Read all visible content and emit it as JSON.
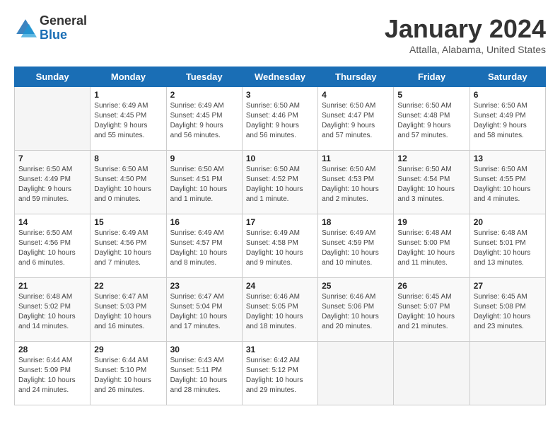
{
  "header": {
    "logo_general": "General",
    "logo_blue": "Blue",
    "title": "January 2024",
    "location": "Attalla, Alabama, United States"
  },
  "days_of_week": [
    "Sunday",
    "Monday",
    "Tuesday",
    "Wednesday",
    "Thursday",
    "Friday",
    "Saturday"
  ],
  "weeks": [
    [
      {
        "day": "",
        "info": ""
      },
      {
        "day": "1",
        "info": "Sunrise: 6:49 AM\nSunset: 4:45 PM\nDaylight: 9 hours\nand 55 minutes."
      },
      {
        "day": "2",
        "info": "Sunrise: 6:49 AM\nSunset: 4:45 PM\nDaylight: 9 hours\nand 56 minutes."
      },
      {
        "day": "3",
        "info": "Sunrise: 6:50 AM\nSunset: 4:46 PM\nDaylight: 9 hours\nand 56 minutes."
      },
      {
        "day": "4",
        "info": "Sunrise: 6:50 AM\nSunset: 4:47 PM\nDaylight: 9 hours\nand 57 minutes."
      },
      {
        "day": "5",
        "info": "Sunrise: 6:50 AM\nSunset: 4:48 PM\nDaylight: 9 hours\nand 57 minutes."
      },
      {
        "day": "6",
        "info": "Sunrise: 6:50 AM\nSunset: 4:49 PM\nDaylight: 9 hours\nand 58 minutes."
      }
    ],
    [
      {
        "day": "7",
        "info": "Sunrise: 6:50 AM\nSunset: 4:49 PM\nDaylight: 9 hours\nand 59 minutes."
      },
      {
        "day": "8",
        "info": "Sunrise: 6:50 AM\nSunset: 4:50 PM\nDaylight: 10 hours\nand 0 minutes."
      },
      {
        "day": "9",
        "info": "Sunrise: 6:50 AM\nSunset: 4:51 PM\nDaylight: 10 hours\nand 1 minute."
      },
      {
        "day": "10",
        "info": "Sunrise: 6:50 AM\nSunset: 4:52 PM\nDaylight: 10 hours\nand 1 minute."
      },
      {
        "day": "11",
        "info": "Sunrise: 6:50 AM\nSunset: 4:53 PM\nDaylight: 10 hours\nand 2 minutes."
      },
      {
        "day": "12",
        "info": "Sunrise: 6:50 AM\nSunset: 4:54 PM\nDaylight: 10 hours\nand 3 minutes."
      },
      {
        "day": "13",
        "info": "Sunrise: 6:50 AM\nSunset: 4:55 PM\nDaylight: 10 hours\nand 4 minutes."
      }
    ],
    [
      {
        "day": "14",
        "info": "Sunrise: 6:50 AM\nSunset: 4:56 PM\nDaylight: 10 hours\nand 6 minutes."
      },
      {
        "day": "15",
        "info": "Sunrise: 6:49 AM\nSunset: 4:56 PM\nDaylight: 10 hours\nand 7 minutes."
      },
      {
        "day": "16",
        "info": "Sunrise: 6:49 AM\nSunset: 4:57 PM\nDaylight: 10 hours\nand 8 minutes."
      },
      {
        "day": "17",
        "info": "Sunrise: 6:49 AM\nSunset: 4:58 PM\nDaylight: 10 hours\nand 9 minutes."
      },
      {
        "day": "18",
        "info": "Sunrise: 6:49 AM\nSunset: 4:59 PM\nDaylight: 10 hours\nand 10 minutes."
      },
      {
        "day": "19",
        "info": "Sunrise: 6:48 AM\nSunset: 5:00 PM\nDaylight: 10 hours\nand 11 minutes."
      },
      {
        "day": "20",
        "info": "Sunrise: 6:48 AM\nSunset: 5:01 PM\nDaylight: 10 hours\nand 13 minutes."
      }
    ],
    [
      {
        "day": "21",
        "info": "Sunrise: 6:48 AM\nSunset: 5:02 PM\nDaylight: 10 hours\nand 14 minutes."
      },
      {
        "day": "22",
        "info": "Sunrise: 6:47 AM\nSunset: 5:03 PM\nDaylight: 10 hours\nand 16 minutes."
      },
      {
        "day": "23",
        "info": "Sunrise: 6:47 AM\nSunset: 5:04 PM\nDaylight: 10 hours\nand 17 minutes."
      },
      {
        "day": "24",
        "info": "Sunrise: 6:46 AM\nSunset: 5:05 PM\nDaylight: 10 hours\nand 18 minutes."
      },
      {
        "day": "25",
        "info": "Sunrise: 6:46 AM\nSunset: 5:06 PM\nDaylight: 10 hours\nand 20 minutes."
      },
      {
        "day": "26",
        "info": "Sunrise: 6:45 AM\nSunset: 5:07 PM\nDaylight: 10 hours\nand 21 minutes."
      },
      {
        "day": "27",
        "info": "Sunrise: 6:45 AM\nSunset: 5:08 PM\nDaylight: 10 hours\nand 23 minutes."
      }
    ],
    [
      {
        "day": "28",
        "info": "Sunrise: 6:44 AM\nSunset: 5:09 PM\nDaylight: 10 hours\nand 24 minutes."
      },
      {
        "day": "29",
        "info": "Sunrise: 6:44 AM\nSunset: 5:10 PM\nDaylight: 10 hours\nand 26 minutes."
      },
      {
        "day": "30",
        "info": "Sunrise: 6:43 AM\nSunset: 5:11 PM\nDaylight: 10 hours\nand 28 minutes."
      },
      {
        "day": "31",
        "info": "Sunrise: 6:42 AM\nSunset: 5:12 PM\nDaylight: 10 hours\nand 29 minutes."
      },
      {
        "day": "",
        "info": ""
      },
      {
        "day": "",
        "info": ""
      },
      {
        "day": "",
        "info": ""
      }
    ]
  ]
}
